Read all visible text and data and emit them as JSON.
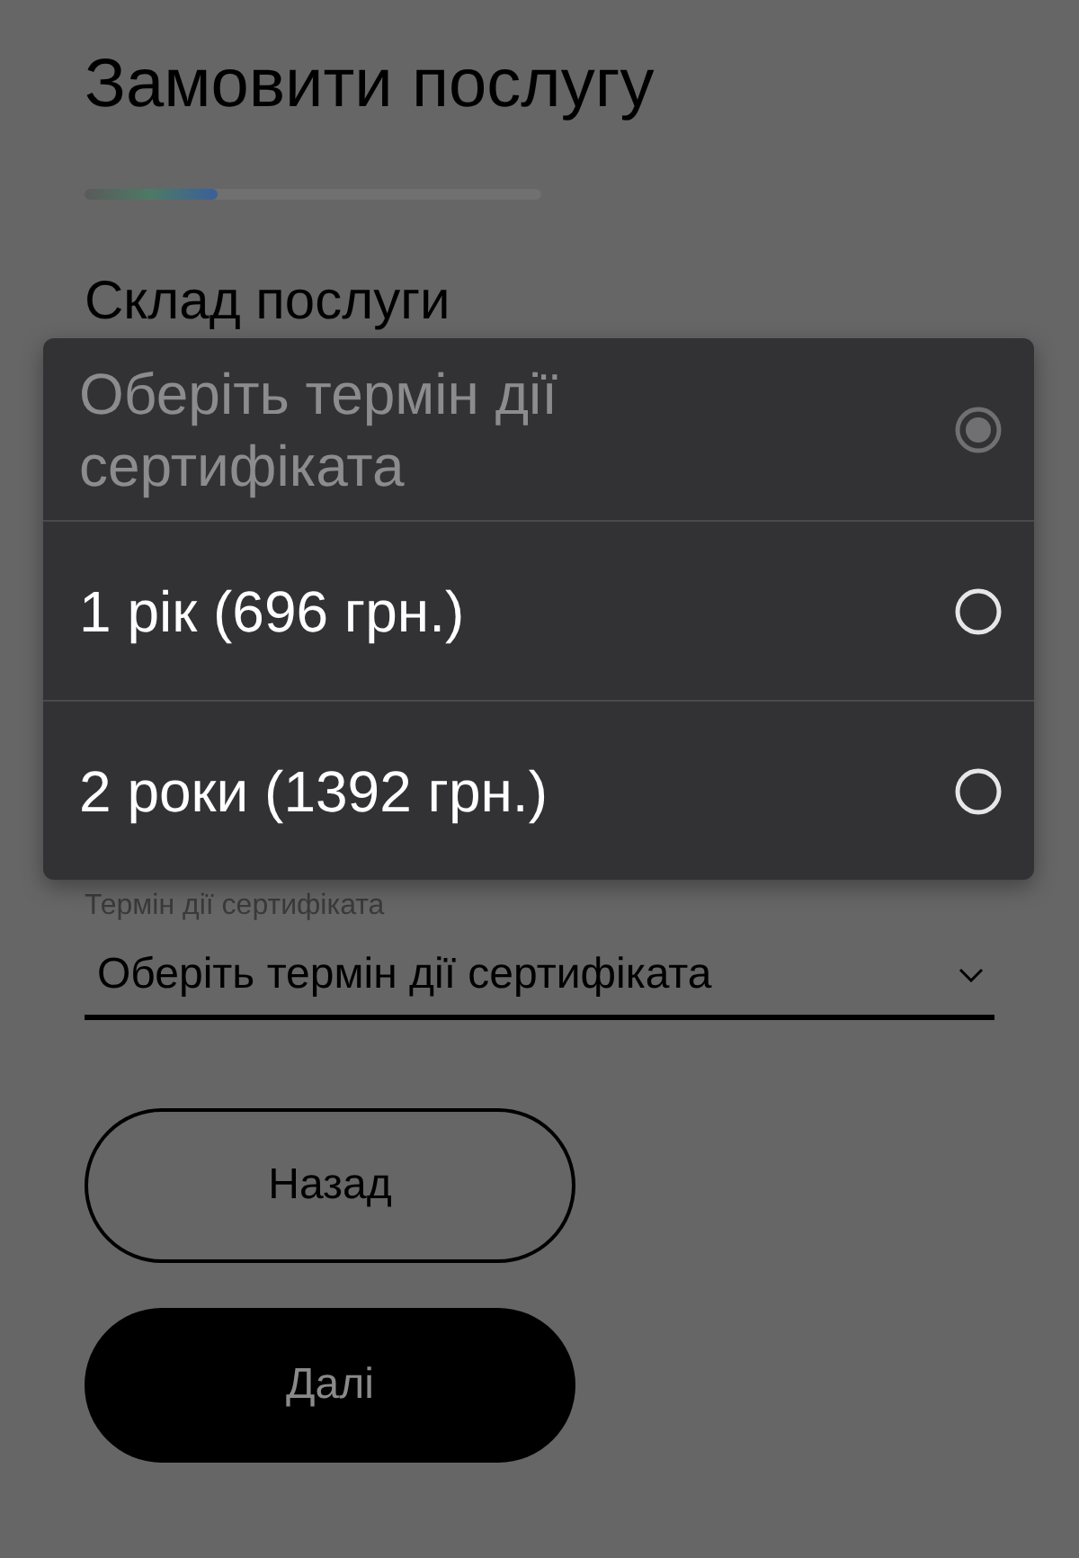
{
  "title": "Замовити послугу",
  "progress": {
    "level": 0.29
  },
  "section_title": "Склад послуги",
  "dialog": {
    "options": [
      {
        "label": "Оберіть термін дії сертифіката",
        "selected": true,
        "disabled": true
      },
      {
        "label": "1 рік (696 грн.)",
        "selected": false,
        "disabled": false
      },
      {
        "label": "2 роки (1392 грн.)",
        "selected": false,
        "disabled": false
      }
    ]
  },
  "select": {
    "label": "Термін дії сертифіката",
    "value": "Оберіть термін дії сертифіката"
  },
  "buttons": [
    {
      "label": "Назад",
      "kind": "outline"
    },
    {
      "label": "Далі",
      "kind": "filled"
    }
  ]
}
